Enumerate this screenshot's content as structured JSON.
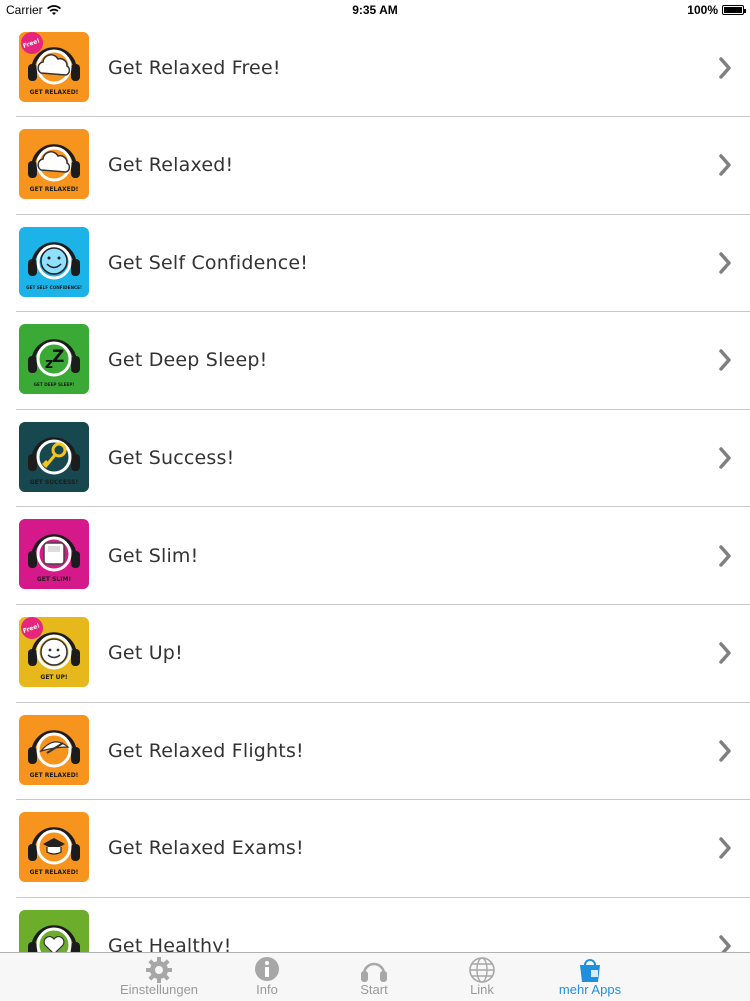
{
  "status": {
    "carrier": "Carrier",
    "time": "9:35 AM",
    "battery": "100%",
    "battery_level": 1.0
  },
  "apps": [
    {
      "label": "Get Relaxed Free!",
      "color": "#f7941d",
      "badge": "Free!",
      "caption": "GET RELAXED!",
      "glyph": "cloud"
    },
    {
      "label": "Get Relaxed!",
      "color": "#f7941d",
      "badge": "",
      "caption": "GET RELAXED!",
      "glyph": "cloud"
    },
    {
      "label": "Get Self Confidence!",
      "color": "#1bb3e8",
      "badge": "",
      "caption": "GET SELF CONFIDENCE!",
      "glyph": "smile"
    },
    {
      "label": "Get Deep Sleep!",
      "color": "#3aa935",
      "badge": "",
      "caption": "GET DEEP SLEEP!",
      "glyph": "zzz"
    },
    {
      "label": "Get Success!",
      "color": "#17474f",
      "badge": "",
      "caption": "GET SUCCESS!",
      "glyph": "key"
    },
    {
      "label": "Get Slim!",
      "color": "#d6198a",
      "badge": "",
      "caption": "GET SLIM!",
      "glyph": "scale"
    },
    {
      "label": "Get Up!",
      "color": "#e6b81c",
      "badge": "Free!",
      "caption": "GET UP!",
      "glyph": "clock"
    },
    {
      "label": "Get Relaxed Flights!",
      "color": "#f7941d",
      "badge": "",
      "caption": "GET RELAXED!",
      "glyph": "plane"
    },
    {
      "label": "Get Relaxed Exams!",
      "color": "#f7941d",
      "badge": "",
      "caption": "GET RELAXED!",
      "glyph": "cap"
    },
    {
      "label": "Get Healthy!",
      "color": "#6cae2c",
      "badge": "",
      "caption": "",
      "glyph": "heart"
    }
  ],
  "tabs": [
    {
      "label": "Einstellungen",
      "icon": "gear-icon",
      "active": false
    },
    {
      "label": "Info",
      "icon": "info-icon",
      "active": false
    },
    {
      "label": "Start",
      "icon": "headphones-icon",
      "active": false
    },
    {
      "label": "Link",
      "icon": "globe-icon",
      "active": false
    },
    {
      "label": "mehr Apps",
      "icon": "app-store-icon",
      "active": true
    }
  ],
  "colors": {
    "accent": "#1f8fe0",
    "tab_inactive": "#9a9a9a",
    "separator": "#c8c7cc",
    "chevron": "#7f7f7f"
  }
}
